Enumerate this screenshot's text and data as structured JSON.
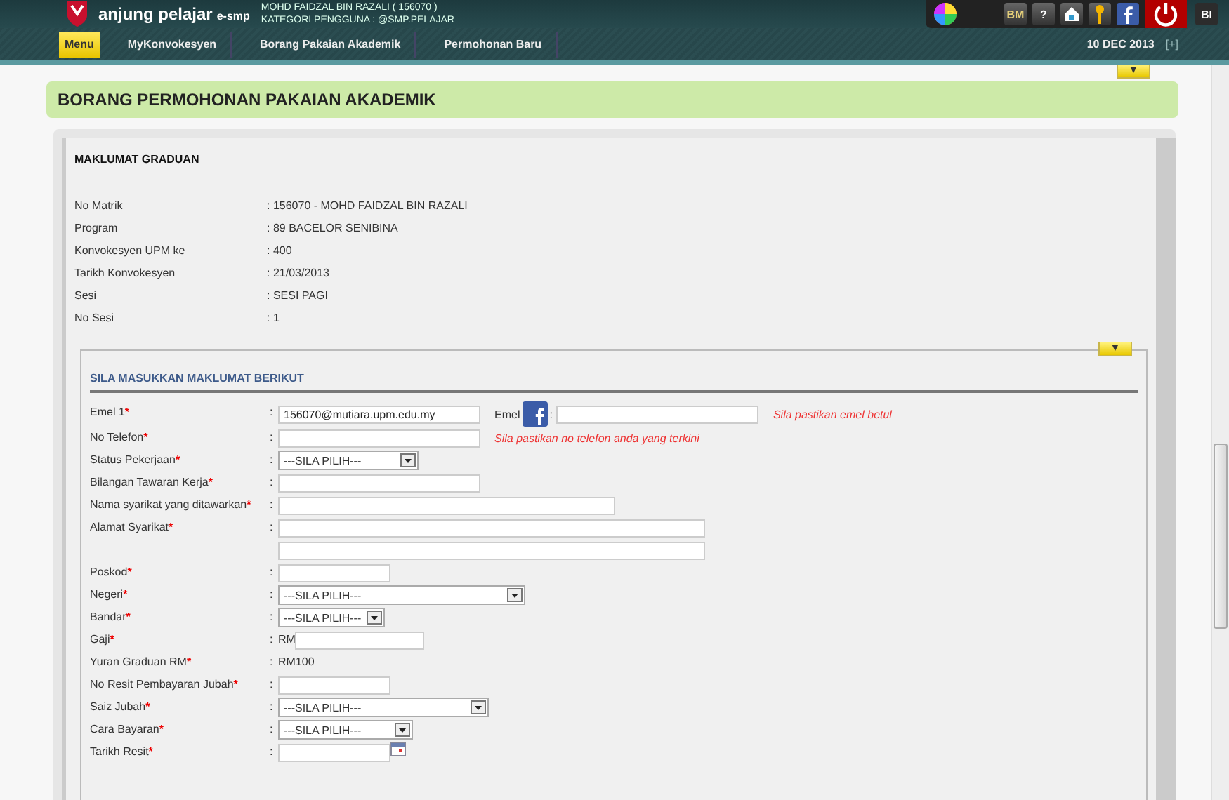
{
  "header": {
    "brand": "anjung pelajar",
    "sub_brand": "e-smp",
    "user": "MOHD FAIDZAL BIN RAZALI ( 156070 )",
    "category": "KATEGORI PENGGUNA : @SMP.PELAJAR",
    "lang_bm": "BM",
    "help": "?",
    "lang_bi": "BI"
  },
  "nav": {
    "menu": "Menu",
    "breadcrumbs": [
      "MyKonvokesyen",
      "Borang Pakaian Akademik",
      "Permohonan Baru"
    ],
    "date": "10 DEC 2013",
    "expand": "[+]",
    "collapse_tab": "▼"
  },
  "page_title": "BORANG PERMOHONAN PAKAIAN AKADEMIK",
  "graduate": {
    "title": "MAKLUMAT GRADUAN",
    "rows": [
      {
        "label": "No Matrik",
        "value": "156070 - MOHD FAIDZAL BIN RAZALI"
      },
      {
        "label": "Program",
        "value": "89 BACELOR SENIBINA"
      },
      {
        "label": "Konvokesyen UPM ke",
        "value": "400"
      },
      {
        "label": "Tarikh Konvokesyen",
        "value": "21/03/2013"
      },
      {
        "label": "Sesi",
        "value": "SESI PAGI"
      },
      {
        "label": "No Sesi",
        "value": "1"
      }
    ]
  },
  "form": {
    "title": "SILA MASUKKAN MAKLUMAT BERIKUT",
    "collapse_tab": "▼",
    "colon": ":",
    "fields": [
      {
        "kind": "email",
        "label": "Emel 1",
        "mark": "*",
        "value": "156070@mutiara.upm.edu.my",
        "second_label": "Emel",
        "hint": "Sila pastikan emel betul"
      },
      {
        "kind": "text",
        "label": "No Telefon",
        "mark": "*",
        "hint": "Sila pastikan no telefon anda yang terkini"
      },
      {
        "kind": "select",
        "label": "Status Pekerjaan",
        "mark": "*",
        "value": "---SILA PILIH---"
      },
      {
        "kind": "text",
        "label": "Bilangan Tawaran Kerja",
        "mark": "*"
      },
      {
        "kind": "text",
        "label": "Nama syarikat yang ditawarkan",
        "mark": "*"
      },
      {
        "kind": "address",
        "label": "Alamat Syarikat",
        "mark": "*"
      },
      {
        "kind": "text",
        "label": "Poskod",
        "mark": "*"
      },
      {
        "kind": "select",
        "label": "Negeri",
        "mark": "*",
        "value": "---SILA PILIH---"
      },
      {
        "kind": "select",
        "label": "Bandar",
        "mark": "*",
        "value": "---SILA PILIH---"
      },
      {
        "kind": "prefixed",
        "label": "Gaji",
        "mark": "*",
        "prefix": "RM"
      },
      {
        "kind": "static",
        "label": "Yuran Graduan RM",
        "mark": "*",
        "value": "RM100"
      },
      {
        "kind": "text",
        "label": "No Resit Pembayaran Jubah",
        "mark": "*"
      },
      {
        "kind": "select",
        "label": "Saiz Jubah",
        "mark": "*",
        "value": "---SILA PILIH---"
      },
      {
        "kind": "select",
        "label": "Cara Bayaran",
        "mark": "*",
        "value": "---SILA PILIH---"
      },
      {
        "kind": "date",
        "label": "Tarikh Resit",
        "mark": "*"
      }
    ]
  }
}
